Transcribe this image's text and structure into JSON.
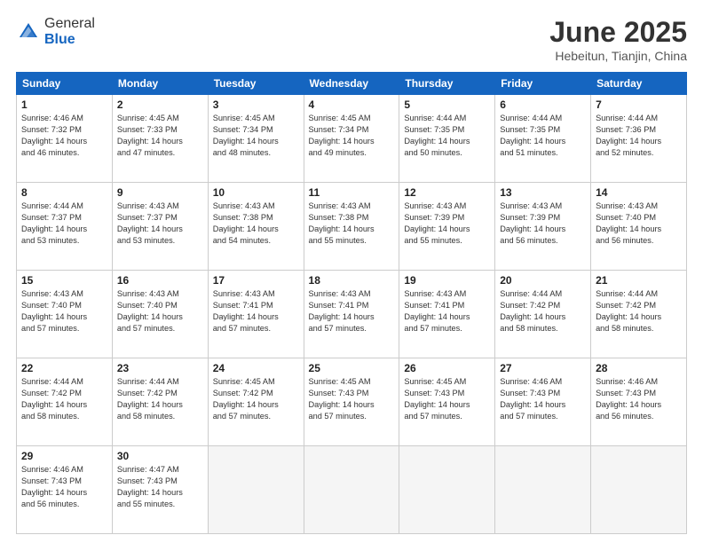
{
  "logo": {
    "general": "General",
    "blue": "Blue"
  },
  "title": "June 2025",
  "subtitle": "Hebeitun, Tianjin, China",
  "days_header": [
    "Sunday",
    "Monday",
    "Tuesday",
    "Wednesday",
    "Thursday",
    "Friday",
    "Saturday"
  ],
  "weeks": [
    [
      {
        "day": "1",
        "info": "Sunrise: 4:46 AM\nSunset: 7:32 PM\nDaylight: 14 hours\nand 46 minutes."
      },
      {
        "day": "2",
        "info": "Sunrise: 4:45 AM\nSunset: 7:33 PM\nDaylight: 14 hours\nand 47 minutes."
      },
      {
        "day": "3",
        "info": "Sunrise: 4:45 AM\nSunset: 7:34 PM\nDaylight: 14 hours\nand 48 minutes."
      },
      {
        "day": "4",
        "info": "Sunrise: 4:45 AM\nSunset: 7:34 PM\nDaylight: 14 hours\nand 49 minutes."
      },
      {
        "day": "5",
        "info": "Sunrise: 4:44 AM\nSunset: 7:35 PM\nDaylight: 14 hours\nand 50 minutes."
      },
      {
        "day": "6",
        "info": "Sunrise: 4:44 AM\nSunset: 7:35 PM\nDaylight: 14 hours\nand 51 minutes."
      },
      {
        "day": "7",
        "info": "Sunrise: 4:44 AM\nSunset: 7:36 PM\nDaylight: 14 hours\nand 52 minutes."
      }
    ],
    [
      {
        "day": "8",
        "info": "Sunrise: 4:44 AM\nSunset: 7:37 PM\nDaylight: 14 hours\nand 53 minutes."
      },
      {
        "day": "9",
        "info": "Sunrise: 4:43 AM\nSunset: 7:37 PM\nDaylight: 14 hours\nand 53 minutes."
      },
      {
        "day": "10",
        "info": "Sunrise: 4:43 AM\nSunset: 7:38 PM\nDaylight: 14 hours\nand 54 minutes."
      },
      {
        "day": "11",
        "info": "Sunrise: 4:43 AM\nSunset: 7:38 PM\nDaylight: 14 hours\nand 55 minutes."
      },
      {
        "day": "12",
        "info": "Sunrise: 4:43 AM\nSunset: 7:39 PM\nDaylight: 14 hours\nand 55 minutes."
      },
      {
        "day": "13",
        "info": "Sunrise: 4:43 AM\nSunset: 7:39 PM\nDaylight: 14 hours\nand 56 minutes."
      },
      {
        "day": "14",
        "info": "Sunrise: 4:43 AM\nSunset: 7:40 PM\nDaylight: 14 hours\nand 56 minutes."
      }
    ],
    [
      {
        "day": "15",
        "info": "Sunrise: 4:43 AM\nSunset: 7:40 PM\nDaylight: 14 hours\nand 57 minutes."
      },
      {
        "day": "16",
        "info": "Sunrise: 4:43 AM\nSunset: 7:40 PM\nDaylight: 14 hours\nand 57 minutes."
      },
      {
        "day": "17",
        "info": "Sunrise: 4:43 AM\nSunset: 7:41 PM\nDaylight: 14 hours\nand 57 minutes."
      },
      {
        "day": "18",
        "info": "Sunrise: 4:43 AM\nSunset: 7:41 PM\nDaylight: 14 hours\nand 57 minutes."
      },
      {
        "day": "19",
        "info": "Sunrise: 4:43 AM\nSunset: 7:41 PM\nDaylight: 14 hours\nand 57 minutes."
      },
      {
        "day": "20",
        "info": "Sunrise: 4:44 AM\nSunset: 7:42 PM\nDaylight: 14 hours\nand 58 minutes."
      },
      {
        "day": "21",
        "info": "Sunrise: 4:44 AM\nSunset: 7:42 PM\nDaylight: 14 hours\nand 58 minutes."
      }
    ],
    [
      {
        "day": "22",
        "info": "Sunrise: 4:44 AM\nSunset: 7:42 PM\nDaylight: 14 hours\nand 58 minutes."
      },
      {
        "day": "23",
        "info": "Sunrise: 4:44 AM\nSunset: 7:42 PM\nDaylight: 14 hours\nand 58 minutes."
      },
      {
        "day": "24",
        "info": "Sunrise: 4:45 AM\nSunset: 7:42 PM\nDaylight: 14 hours\nand 57 minutes."
      },
      {
        "day": "25",
        "info": "Sunrise: 4:45 AM\nSunset: 7:43 PM\nDaylight: 14 hours\nand 57 minutes."
      },
      {
        "day": "26",
        "info": "Sunrise: 4:45 AM\nSunset: 7:43 PM\nDaylight: 14 hours\nand 57 minutes."
      },
      {
        "day": "27",
        "info": "Sunrise: 4:46 AM\nSunset: 7:43 PM\nDaylight: 14 hours\nand 57 minutes."
      },
      {
        "day": "28",
        "info": "Sunrise: 4:46 AM\nSunset: 7:43 PM\nDaylight: 14 hours\nand 56 minutes."
      }
    ],
    [
      {
        "day": "29",
        "info": "Sunrise: 4:46 AM\nSunset: 7:43 PM\nDaylight: 14 hours\nand 56 minutes."
      },
      {
        "day": "30",
        "info": "Sunrise: 4:47 AM\nSunset: 7:43 PM\nDaylight: 14 hours\nand 55 minutes."
      },
      {
        "day": "",
        "info": ""
      },
      {
        "day": "",
        "info": ""
      },
      {
        "day": "",
        "info": ""
      },
      {
        "day": "",
        "info": ""
      },
      {
        "day": "",
        "info": ""
      }
    ]
  ]
}
